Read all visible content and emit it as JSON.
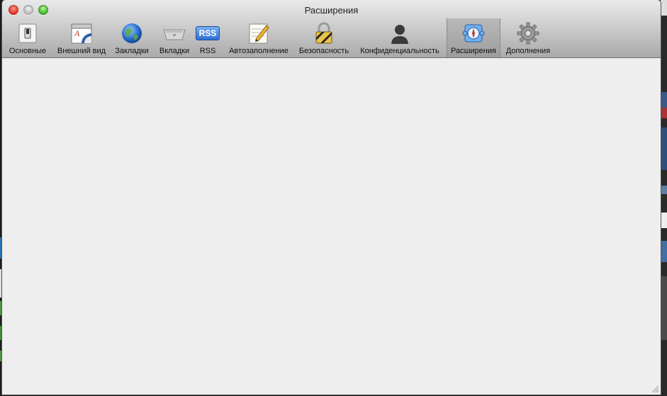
{
  "window": {
    "title": "Расширения"
  },
  "toolbar": {
    "items": [
      {
        "label": "Основные",
        "icon": "switch-icon",
        "selected": false
      },
      {
        "label": "Внешний вид",
        "icon": "appearance-icon",
        "selected": false
      },
      {
        "label": "Закладки",
        "icon": "globe-icon",
        "selected": false
      },
      {
        "label": "Вкладки",
        "icon": "tabs-icon",
        "selected": false
      },
      {
        "label": "RSS",
        "icon": "rss-icon",
        "selected": false
      },
      {
        "label": "Автозаполнение",
        "icon": "pencil-icon",
        "selected": false
      },
      {
        "label": "Безопасность",
        "icon": "lock-icon",
        "selected": false
      },
      {
        "label": "Конфиденциальность",
        "icon": "person-silhouette-icon",
        "selected": false
      },
      {
        "label": "Расширения",
        "icon": "puzzle-compass-icon",
        "selected": true
      },
      {
        "label": "Дополнения",
        "icon": "gear-icon",
        "selected": false
      }
    ],
    "rss_badge": "RSS"
  },
  "colors": {
    "close": "#e0362b",
    "minimize": "#bdbdbd",
    "zoom": "#44b72c",
    "content_bg": "#eeeeee"
  }
}
